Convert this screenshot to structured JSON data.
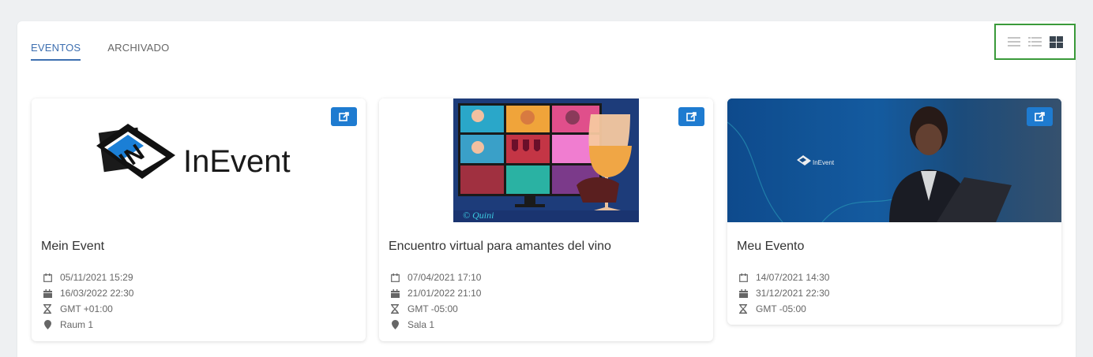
{
  "tabs": [
    {
      "label": "EVENTOS",
      "active": true
    },
    {
      "label": "ARCHIVADO",
      "active": false
    }
  ],
  "view_modes": [
    {
      "icon": "list-icon",
      "selected": false
    },
    {
      "icon": "detailed-list-icon",
      "selected": false
    },
    {
      "icon": "grid-icon",
      "selected": true
    }
  ],
  "colors": {
    "accent": "#3d6fb0",
    "button": "#1e7bd0",
    "highlight": "#3a9a3a"
  },
  "events": [
    {
      "title": "Mein Event",
      "start": "05/11/2021 15:29",
      "end": "16/03/2022 22:30",
      "timezone": "GMT +01:00",
      "location": "Raum 1",
      "image_logo_text": "InEvent"
    },
    {
      "title": "Encuentro virtual para amantes del vino",
      "start": "07/04/2021 17:10",
      "end": "21/01/2022 21:10",
      "timezone": "GMT -05:00",
      "location": "Sala 1",
      "image_caption": "© Quini"
    },
    {
      "title": "Meu Evento",
      "start": "14/07/2021 14:30",
      "end": "31/12/2021 22:30",
      "timezone": "GMT -05:00",
      "image_logo_text": "InEvent"
    }
  ]
}
